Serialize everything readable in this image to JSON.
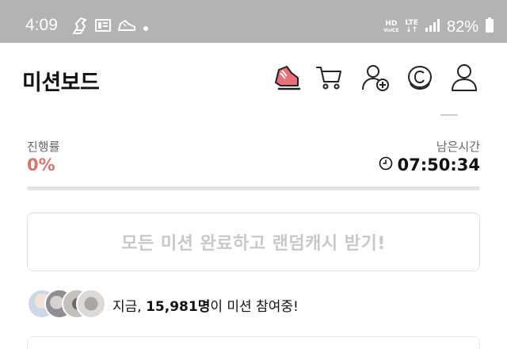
{
  "status_bar": {
    "time": "4:09",
    "network_hd": "HD",
    "network_voice": "VoICE",
    "network_type": "LTE",
    "battery": "82%"
  },
  "header": {
    "title": "미션보드",
    "icons": [
      "sneaker-icon",
      "cart-icon",
      "add-friend-icon",
      "coin-icon",
      "profile-icon"
    ]
  },
  "progress": {
    "label": "진행률",
    "value": "0%",
    "fraction": 0
  },
  "remaining": {
    "label": "남은시간",
    "value": "07:50:34"
  },
  "reward_button": {
    "label": "모든 미션 완료하고 랜덤캐시 받기!"
  },
  "participants": {
    "prefix": "지금, ",
    "count": "15,981명",
    "suffix": "이 미션 참여중!"
  },
  "colors": {
    "accent": "#d9756c",
    "status_bar": "#b3b3b3",
    "disabled_text": "#c8c8c8"
  }
}
